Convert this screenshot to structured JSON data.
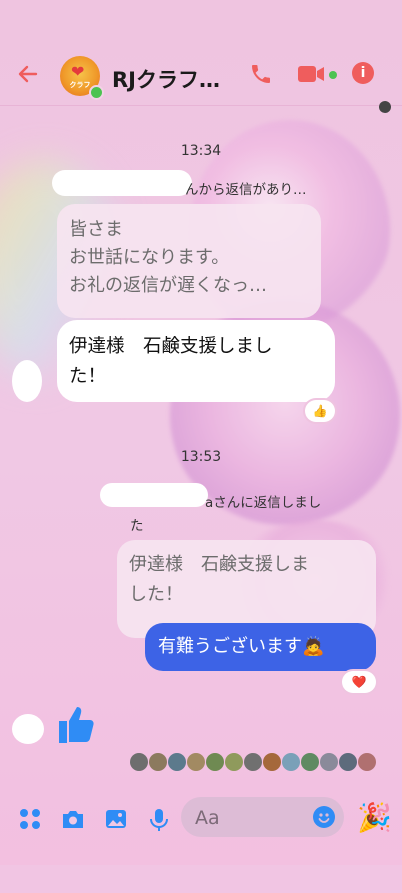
{
  "header": {
    "title": "RJクラフ…",
    "avatar_brand": "クラフ"
  },
  "messages": {
    "time1": "13:34",
    "reply1_note": "んから返信があり…",
    "quote1_lines": [
      "皆さま",
      "お世話になります。",
      "お礼の返信が遅くなっ…"
    ],
    "msg1_lines": [
      "伊達様　石鹸支援しまし",
      "た！"
    ],
    "reaction1": "👍",
    "time2": "13:53",
    "reply2_note_line1": "aさんに返信しまし",
    "reply2_note_line2": "た",
    "quote2_lines": [
      "伊達様　石鹸支援しま",
      "した！"
    ],
    "msg2": "有難うございます🙇",
    "reaction2": "❤️"
  },
  "composer": {
    "placeholder": "Aa"
  },
  "colors": {
    "accent": "#ef5d5d",
    "bubble_blue": "#3d63e6",
    "like_blue": "#2f8cf5"
  },
  "icons": [
    "back-arrow-icon",
    "phone-icon",
    "video-camera-icon",
    "info-icon",
    "apps-icon",
    "camera-icon",
    "gallery-icon",
    "microphone-icon",
    "emoji-icon",
    "party-popper-icon",
    "thumbs-up-icon"
  ]
}
